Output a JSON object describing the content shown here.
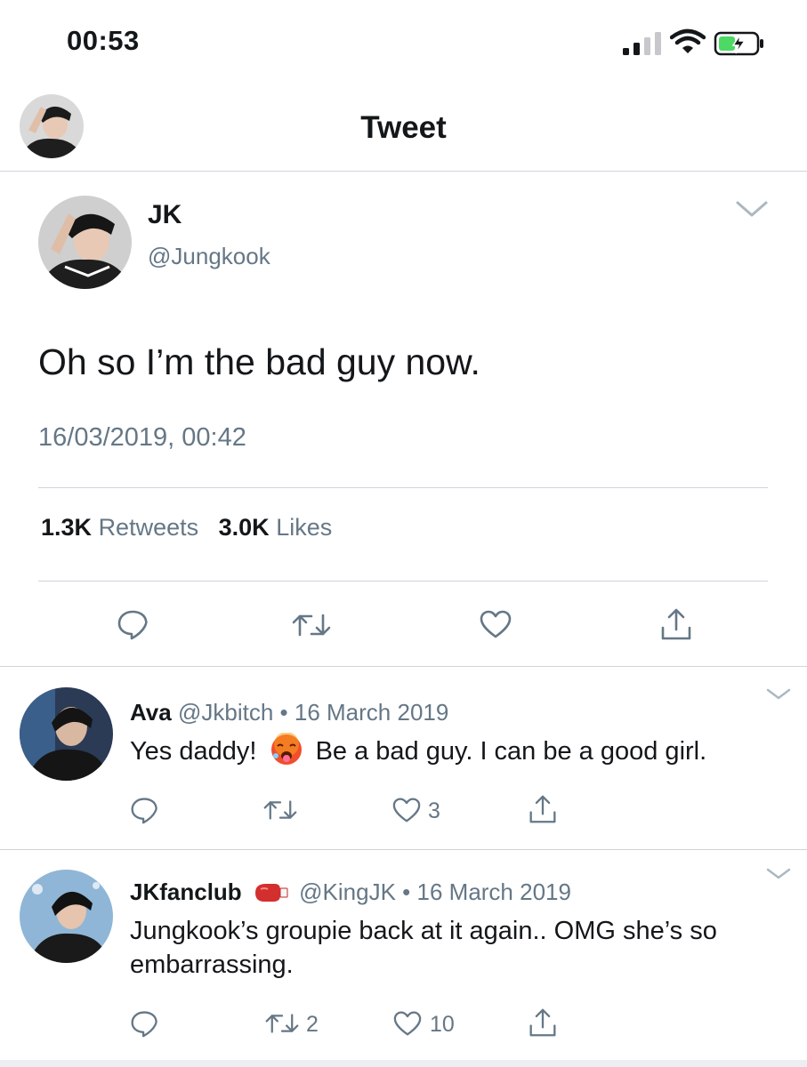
{
  "status_bar": {
    "time": "00:53"
  },
  "nav": {
    "title": "Tweet"
  },
  "tweet": {
    "name": "JK",
    "handle": "@Jungkook",
    "text": "Oh so I’m the bad guy now.",
    "timestamp": "16/03/2019, 00:42",
    "retweets_count": "1.3K",
    "retweets_label": "Retweets",
    "likes_count": "3.0K",
    "likes_label": "Likes"
  },
  "replies": [
    {
      "name": "Ava",
      "handle": "@Jkbitch",
      "separator": "•",
      "date": "16 March 2019",
      "text_before_emoji": "Yes daddy!",
      "emoji": "hot-face-emoji",
      "text_after_emoji": "Be a bad guy. I can be a good girl.",
      "retweet_count": "",
      "like_count": "3"
    },
    {
      "name": "JKfanclub",
      "name_badge": "boxing-glove-emoji",
      "handle": "@KingJK",
      "separator": "•",
      "date": "16 March 2019",
      "text": "Jungkook’s groupie back at it again.. OMG she’s so embarrassing.",
      "retweet_count": "2",
      "like_count": "10"
    }
  ],
  "colors": {
    "text": "#14171a",
    "secondary": "#657786",
    "divider": "#cfd5da",
    "battery": "#4cd964"
  }
}
